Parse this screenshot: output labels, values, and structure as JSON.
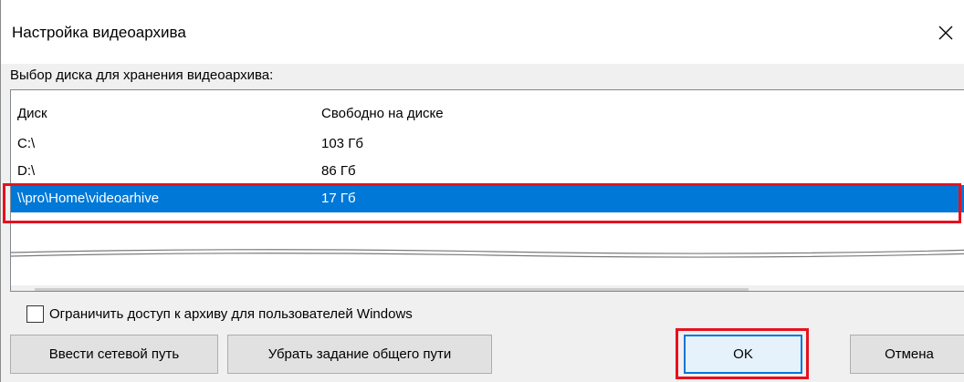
{
  "window": {
    "title": "Настройка видеоархива"
  },
  "group": {
    "label": "Выбор диска для хранения видеоархива:"
  },
  "listview": {
    "columns": [
      "Диск",
      "Свободно на диске"
    ],
    "rows": [
      {
        "disk": "C:\\",
        "free": "103 Гб",
        "selected": false
      },
      {
        "disk": "D:\\",
        "free": "86 Гб",
        "selected": false
      },
      {
        "disk": "\\\\pro\\Home\\videoarhive",
        "free": "17 Гб",
        "selected": true
      }
    ]
  },
  "checkbox": {
    "label": "Ограничить доступ к архиву для пользователей Windows",
    "checked": false
  },
  "buttons": {
    "network_path": "Ввести сетевой путь",
    "remove_path": "Убрать задание общего пути",
    "ok": "OK",
    "cancel": "Отмена"
  },
  "colors": {
    "selection": "#0078d7",
    "highlight": "#e8101e"
  }
}
